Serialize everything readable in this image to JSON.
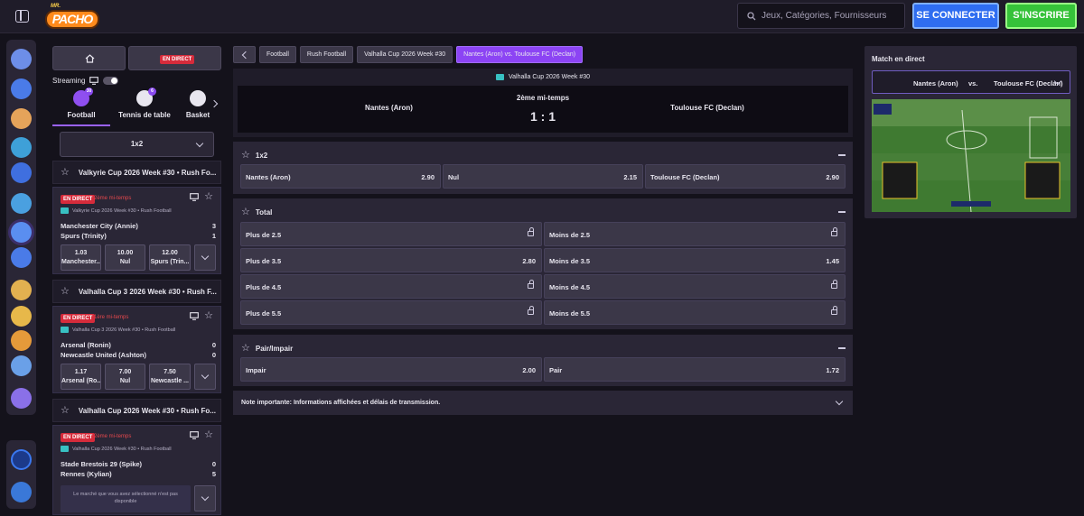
{
  "brand": {
    "logo_small": "MR.",
    "logo_main": "PACHO"
  },
  "header": {
    "search_placeholder": "Jeux, Catégories, Fournisseurs",
    "login": "SE CONNECTER",
    "signup": "S'INSCRIRE"
  },
  "left": {
    "live_label": "EN DIRECT",
    "streaming_label": "Streaming",
    "sports": [
      {
        "label": "Football",
        "badge": "30"
      },
      {
        "label": "Tennis de table",
        "badge": "6"
      },
      {
        "label": "Basket"
      }
    ],
    "market_select": "1x2",
    "leagues": [
      {
        "title": "Valkyrie Cup 2026 Week #30 • Rush Fo...",
        "match": {
          "live": "EN DIRECT",
          "period": "2ème mi-temps",
          "competition": "Valkyrie Cup 2026 Week #30 • Rush Football",
          "home": "Manchester City (Annie)",
          "home_score": "3",
          "away": "Spurs (Trinity)",
          "away_score": "1",
          "odds": [
            {
              "value": "1.03",
              "label": "Manchester..."
            },
            {
              "value": "10.00",
              "label": "Nul"
            },
            {
              "value": "12.00",
              "label": "Spurs (Trin..."
            }
          ]
        }
      },
      {
        "title": "Valhalla Cup 3 2026 Week #30 • Rush F...",
        "match": {
          "live": "EN DIRECT",
          "period": "1ère mi-temps",
          "competition": "Valhalla Cup 3 2026 Week #30 • Rush Football",
          "home": "Arsenal (Ronin)",
          "home_score": "0",
          "away": "Newcastle United (Ashton)",
          "away_score": "0",
          "odds": [
            {
              "value": "1.17",
              "label": "Arsenal (Ro..."
            },
            {
              "value": "7.00",
              "label": "Nul"
            },
            {
              "value": "7.50",
              "label": "Newcastle ..."
            }
          ]
        }
      },
      {
        "title": "Valhalla Cup 2026 Week #30 • Rush Fo...",
        "match": {
          "live": "EN DIRECT",
          "period": "2ème mi-temps",
          "competition": "Valhalla Cup 2026 Week #30 • Rush Football",
          "home": "Stade Brestois 29 (Spike)",
          "home_score": "0",
          "away": "Rennes (Kylian)",
          "away_score": "5",
          "unavailable": "Le marché que vous avez sélectionné n'est pas disponible"
        }
      }
    ]
  },
  "breadcrumbs": [
    "Football",
    "Rush Football",
    "Valhalla Cup 2026 Week #30",
    "Nantes (Aron) vs. Toulouse FC (Declan)"
  ],
  "event": {
    "competition": "Valhalla Cup 2026 Week #30",
    "home": "Nantes (Aron)",
    "away": "Toulouse FC (Declan)",
    "period": "2ème mi-temps",
    "score": "1 : 1"
  },
  "markets": {
    "m1x2": {
      "title": "1x2",
      "cells": [
        {
          "label": "Nantes (Aron)",
          "value": "2.90"
        },
        {
          "label": "Nul",
          "value": "2.15"
        },
        {
          "label": "Toulouse FC (Declan)",
          "value": "2.90"
        }
      ]
    },
    "total": {
      "title": "Total",
      "rows": [
        [
          {
            "label": "Plus de 2.5",
            "locked": true
          },
          {
            "label": "Moins de 2.5",
            "locked": true
          }
        ],
        [
          {
            "label": "Plus de 3.5",
            "value": "2.80"
          },
          {
            "label": "Moins de 3.5",
            "value": "1.45"
          }
        ],
        [
          {
            "label": "Plus de 4.5",
            "locked": true
          },
          {
            "label": "Moins de 4.5",
            "locked": true
          }
        ],
        [
          {
            "label": "Plus de 5.5",
            "locked": true
          },
          {
            "label": "Moins de 5.5",
            "locked": true
          }
        ]
      ]
    },
    "pair": {
      "title": "Pair/Impair",
      "cells": [
        {
          "label": "Impair",
          "value": "2.00"
        },
        {
          "label": "Pair",
          "value": "1.72"
        }
      ]
    },
    "note": "Note importante: Informations affichées et délais de transmission."
  },
  "right": {
    "title": "Match en direct",
    "home": "Nantes (Aron)",
    "vs": "vs.",
    "away": "Toulouse FC (Declan)"
  }
}
